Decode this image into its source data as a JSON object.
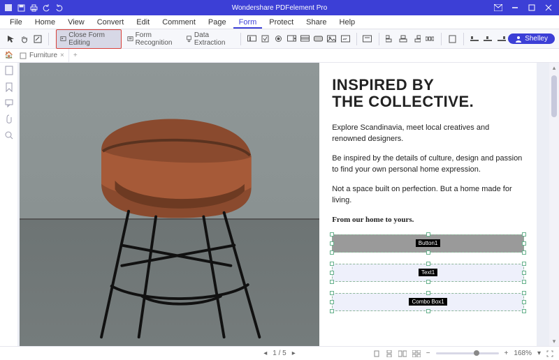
{
  "app": {
    "title": "Wondershare PDFelement Pro"
  },
  "menu": [
    "File",
    "Home",
    "View",
    "Convert",
    "Edit",
    "Comment",
    "Page",
    "Form",
    "Protect",
    "Share",
    "Help"
  ],
  "menu_active": "Form",
  "ribbon": {
    "close_form": "Close Form Editing",
    "form_recognition": "Form Recognition",
    "data_extraction": "Data Extraction",
    "user": "Shelley"
  },
  "tab": {
    "name": "Furniture"
  },
  "doc": {
    "heading_l1": "INSPIRED BY",
    "heading_l2": "THE COLLECTIVE.",
    "p1": "Explore Scandinavia, meet local creatives and renowned designers.",
    "p2": "Be inspired by the details of culture, design and passion to find your own personal home expression.",
    "p3": "Not a space built on perfection. But a home made for living.",
    "p4": "From our home to yours.",
    "fields": {
      "button": "Button1",
      "text": "Text1",
      "combo": "Combo Box1"
    }
  },
  "status": {
    "page": "1",
    "pages": "5",
    "zoom": "168%"
  }
}
